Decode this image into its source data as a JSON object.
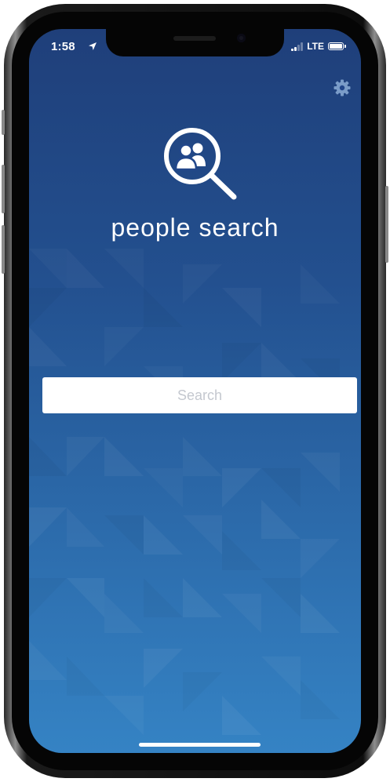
{
  "status_bar": {
    "time": "1:58",
    "network": "LTE",
    "icons": [
      "location-arrow-icon",
      "signal-icon",
      "battery-icon"
    ]
  },
  "header": {
    "settings_icon": "gear-icon"
  },
  "logo": {
    "icon": "people-search-icon"
  },
  "app": {
    "title": "people search"
  },
  "search": {
    "placeholder": "Search",
    "value": ""
  },
  "colors": {
    "background_top": "#1f3f7a",
    "background_bottom": "#3583c4",
    "foreground": "#ffffff",
    "placeholder": "#c4c8cf",
    "gear": "#7a9cc8"
  }
}
